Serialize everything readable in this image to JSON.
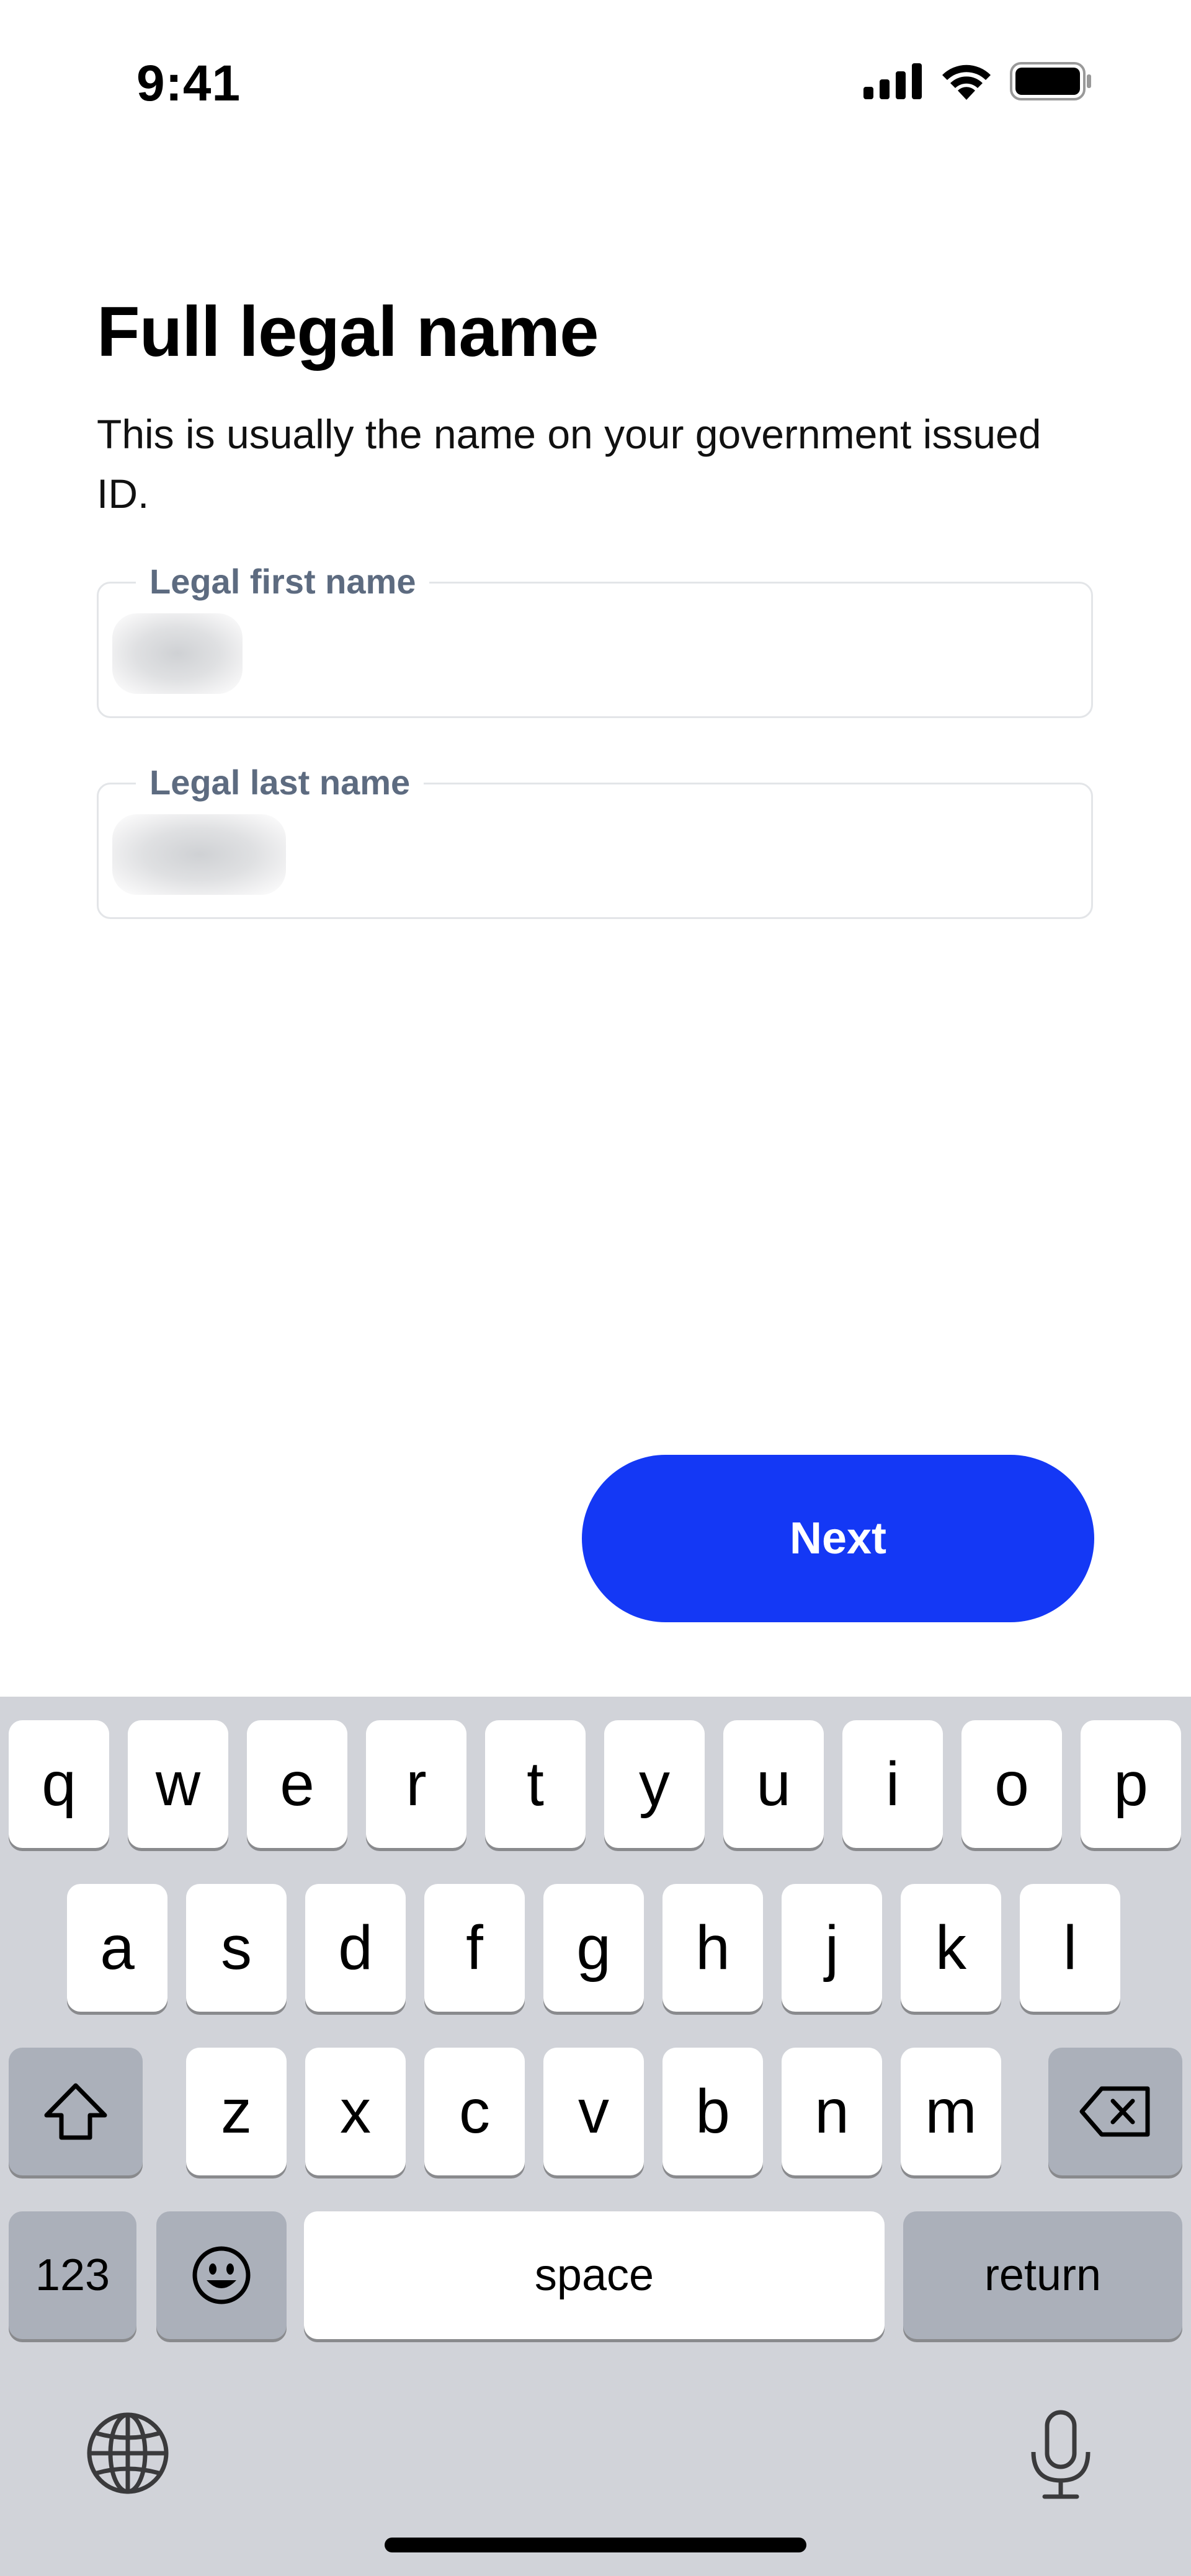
{
  "status_bar": {
    "time": "9:41"
  },
  "form": {
    "title": "Full legal name",
    "subtitle": "This is usually the name on your government issued ID.",
    "first_name": {
      "label": "Legal first name",
      "value": ""
    },
    "last_name": {
      "label": "Legal last name",
      "value": ""
    },
    "next_label": "Next"
  },
  "colors": {
    "accent": "#1438f5",
    "label": "#5d6b80",
    "keyboard_bg": "#d1d3d9"
  },
  "keyboard": {
    "row1": [
      "q",
      "w",
      "e",
      "r",
      "t",
      "y",
      "u",
      "i",
      "o",
      "p"
    ],
    "row2": [
      "a",
      "s",
      "d",
      "f",
      "g",
      "h",
      "j",
      "k",
      "l"
    ],
    "row3": [
      "z",
      "x",
      "c",
      "v",
      "b",
      "n",
      "m"
    ],
    "numbers_label": "123",
    "space_label": "space",
    "return_label": "return",
    "icons": [
      "shift-icon",
      "backspace-icon",
      "emoji-icon",
      "globe-icon",
      "microphone-icon"
    ]
  }
}
